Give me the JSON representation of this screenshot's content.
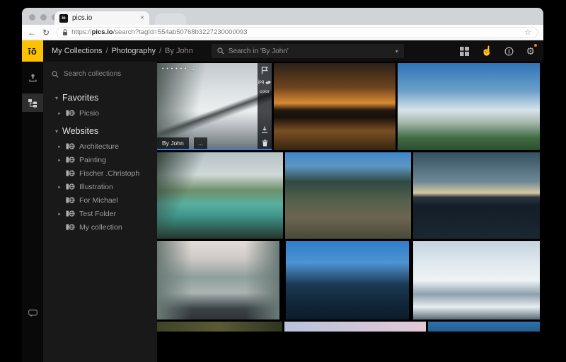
{
  "colors": {
    "accent_yellow": "#fcc200",
    "selection_blue": "#2f7fe8",
    "notification_orange": "#e87b2e"
  },
  "browser": {
    "tab_title": "pics.io",
    "favicon_text": "io",
    "tab_close": "×",
    "back_arrow": "←",
    "reload": "↻",
    "url_scheme": "https://",
    "url_domain": "pics.io",
    "url_path": "/search?tagId=554ab50768b3227230000093",
    "bookmark_star": "☆"
  },
  "header": {
    "logo_text": "īō",
    "breadcrumb": [
      {
        "label": "My Collections"
      },
      {
        "label": "Photography"
      },
      {
        "label": "By John"
      }
    ],
    "breadcrumb_sep": "/",
    "search_placeholder": "Search in 'By John'",
    "search_caret": "▾"
  },
  "sidebar": {
    "search_placeholder": "Search collections",
    "tree": [
      {
        "label": "Favorites",
        "arrow": "▾"
      },
      {
        "label": "Picsio",
        "arrow": "▸"
      },
      {
        "label": "Websites",
        "arrow": "▾"
      },
      {
        "label": "Architecture",
        "arrow": "▸"
      },
      {
        "label": "Painting",
        "arrow": "▸"
      },
      {
        "label": "Fischer .Christoph",
        "arrow": ""
      },
      {
        "label": "Illustration",
        "arrow": "▸"
      },
      {
        "label": "For Michael",
        "arrow": ""
      },
      {
        "label": "Test Folder",
        "arrow": "▸"
      },
      {
        "label": "My collection",
        "arrow": ""
      }
    ]
  },
  "grid": {
    "active_tile": {
      "owner_badge": "By John",
      "more_label": "...",
      "format_label": "jpg",
      "color_label": "color",
      "dots": "• • • • • •",
      "dots_arrow": "→"
    },
    "photos": [
      {
        "name": "snowy-road-fence"
      },
      {
        "name": "sunset-bridge"
      },
      {
        "name": "mountain-village"
      },
      {
        "name": "mountain-lake"
      },
      {
        "name": "valley-river"
      },
      {
        "name": "dusk-bridge"
      },
      {
        "name": "snowy-forest-road"
      },
      {
        "name": "blue-mountains"
      },
      {
        "name": "snow-peaks"
      },
      {
        "name": "forest-hill-partial"
      },
      {
        "name": "pink-sky-partial"
      },
      {
        "name": "blue-water-partial"
      }
    ]
  }
}
